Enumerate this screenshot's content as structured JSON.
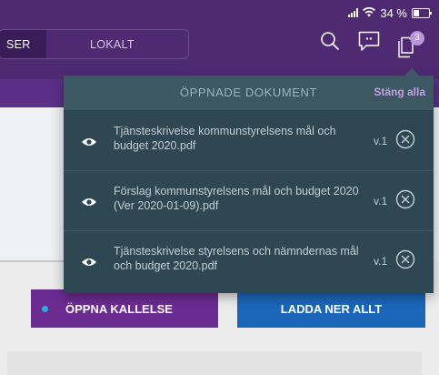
{
  "status_bar": {
    "battery": "34 %"
  },
  "header": {
    "segments": [
      "SER",
      "LOKALT"
    ],
    "icons": [
      "search-icon",
      "chat-icon",
      "documents-icon"
    ],
    "badge_count": "3"
  },
  "popover": {
    "title": "ÖPPNADE DOKUMENT",
    "close_all": "Stäng alla",
    "documents": [
      {
        "title": "Tjänsteskrivelse kommunstyrelsens mål och budget 2020.pdf",
        "version": "v.1"
      },
      {
        "title": "Förslag kommunstyrelsens mål och budget 2020 (Ver 2020-01-09).pdf",
        "version": "v.1"
      },
      {
        "title": "Tjänsteskrivelse styrelsens och nämndernas mål och budget 2020.pdf",
        "version": "v.1"
      }
    ]
  },
  "actions": {
    "open_label": "ÖPPNA KALLELSE",
    "download_label": "LADDA NER ALLT"
  },
  "colors": {
    "header_bg": "#4f2a73",
    "popover_bg": "#2f4752",
    "open_button": "#6b2c91",
    "download_button": "#1b66b8",
    "accent_link": "#c3a0e6"
  }
}
